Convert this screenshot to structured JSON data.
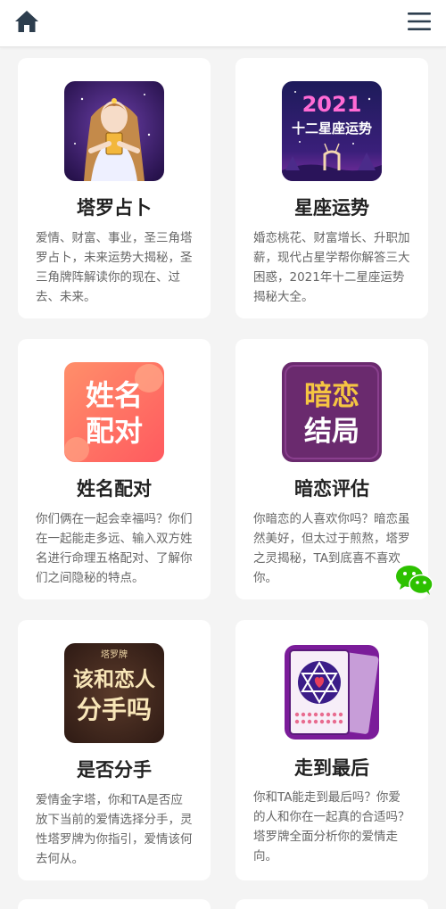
{
  "header": {
    "home_icon": "home-icon",
    "menu_icon": "hamburger-menu-icon"
  },
  "cards": [
    {
      "title": "塔罗占卜",
      "desc": "爱情、财富、事业，圣三角塔罗占卜，未来运势大揭秘，圣三角牌阵解读你的现在、过去、未来。",
      "thumb": "tarot-goddess"
    },
    {
      "title": "星座运势",
      "desc": "婚恋桃花、财富增长、升职加薪，现代占星学帮你解答三大困惑，2021年十二星座运势揭秘大全。",
      "thumb_text_1": "2021",
      "thumb_text_2": "十二星座运势"
    },
    {
      "title": "姓名配对",
      "desc": "你们俩在一起会幸福吗？你们在一起能走多远、输入双方姓名进行命理五格配对、了解你们之间隐秘的特点。",
      "thumb_text_1": "姓名",
      "thumb_text_2": "配对"
    },
    {
      "title": "暗恋评估",
      "desc": "你暗恋的人喜欢你吗？暗恋虽然美好，但太过于煎熬，塔罗之灵揭秘，TA到底喜不喜欢你。",
      "thumb_text_1": "暗恋",
      "thumb_text_2": "结局"
    },
    {
      "title": "是否分手",
      "desc": "爱情金字塔，你和TA是否应放下当前的爱情选择分手，灵性塔罗牌为你指引，爱情该何去何从。",
      "thumb_text_0": "塔罗牌",
      "thumb_text_1": "该和恋人",
      "thumb_text_2": "分手吗"
    },
    {
      "title": "走到最后",
      "desc": "你和TA能走到最后吗？你爱的人和你在一起真的合适吗？塔罗牌全面分析你的爱情走向。",
      "thumb": "tarot-cards"
    }
  ],
  "floating": {
    "icon": "wechat-icon"
  }
}
